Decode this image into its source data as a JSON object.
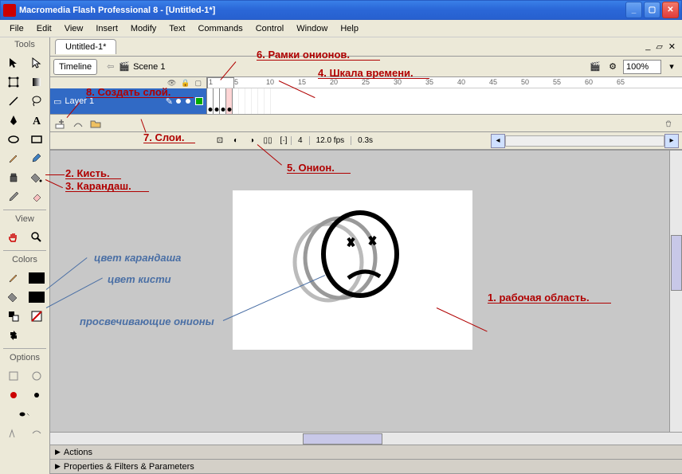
{
  "app": {
    "title": "Macromedia Flash Professional 8 - [Untitled-1*]"
  },
  "menu": {
    "file": "File",
    "edit": "Edit",
    "view": "View",
    "insert": "Insert",
    "modify": "Modify",
    "text": "Text",
    "commands": "Commands",
    "control": "Control",
    "window": "Window",
    "help": "Help"
  },
  "tools_panel": {
    "title": "Tools",
    "view_title": "View",
    "colors_title": "Colors",
    "options_title": "Options"
  },
  "document": {
    "tab": "Untitled-1*",
    "timeline_btn": "Timeline",
    "scene": "Scene 1",
    "zoom": "100%"
  },
  "timeline": {
    "layer": "Layer 1",
    "ruler_marks": [
      "1",
      "5",
      "10",
      "15",
      "20",
      "25",
      "30",
      "35",
      "40",
      "45",
      "50",
      "55",
      "60",
      "65"
    ],
    "current_frame": "4",
    "fps": "12.0 fps",
    "elapsed": "0.3s"
  },
  "panels": {
    "actions": "Actions",
    "properties": "Properties & Filters & Parameters"
  },
  "annotations": {
    "a1": "1. рабочая область.",
    "a2": "2. Кисть.",
    "a3": "3. Карандаш.",
    "a4": "4. Шкала времени.",
    "a5": "5. Онион.",
    "a6": "6. Рамки онионов.",
    "a7": "7. Слои.",
    "a8": "8. Создать слой.",
    "b1": "цвет карандаша",
    "b2": "цвет кисти",
    "b3": "просвечивающие онионы"
  },
  "colors": {
    "stroke": "#000000",
    "fill": "#000000",
    "accent_green": "#00aa00"
  }
}
